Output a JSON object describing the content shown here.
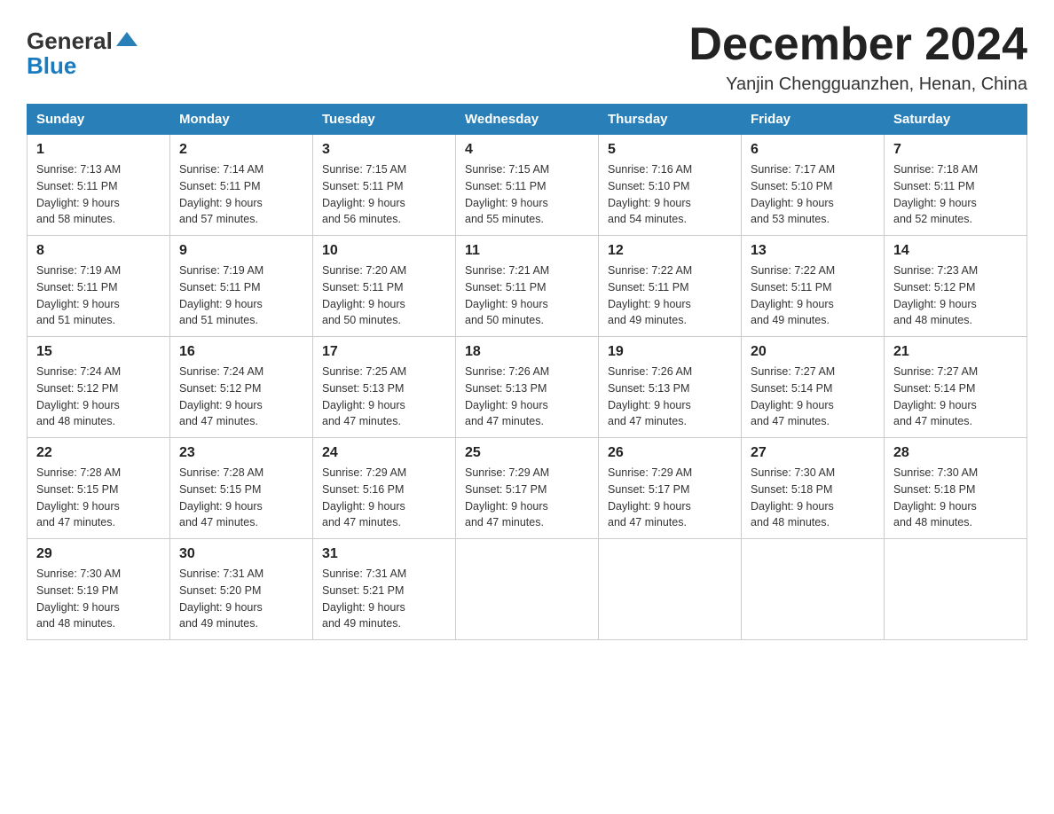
{
  "logo": {
    "general": "General",
    "blue": "Blue"
  },
  "header": {
    "title": "December 2024",
    "subtitle": "Yanjin Chengguanzhen, Henan, China"
  },
  "weekdays": [
    "Sunday",
    "Monday",
    "Tuesday",
    "Wednesday",
    "Thursday",
    "Friday",
    "Saturday"
  ],
  "weeks": [
    [
      {
        "day": "1",
        "sunrise": "7:13 AM",
        "sunset": "5:11 PM",
        "daylight": "9 hours and 58 minutes."
      },
      {
        "day": "2",
        "sunrise": "7:14 AM",
        "sunset": "5:11 PM",
        "daylight": "9 hours and 57 minutes."
      },
      {
        "day": "3",
        "sunrise": "7:15 AM",
        "sunset": "5:11 PM",
        "daylight": "9 hours and 56 minutes."
      },
      {
        "day": "4",
        "sunrise": "7:15 AM",
        "sunset": "5:11 PM",
        "daylight": "9 hours and 55 minutes."
      },
      {
        "day": "5",
        "sunrise": "7:16 AM",
        "sunset": "5:10 PM",
        "daylight": "9 hours and 54 minutes."
      },
      {
        "day": "6",
        "sunrise": "7:17 AM",
        "sunset": "5:10 PM",
        "daylight": "9 hours and 53 minutes."
      },
      {
        "day": "7",
        "sunrise": "7:18 AM",
        "sunset": "5:11 PM",
        "daylight": "9 hours and 52 minutes."
      }
    ],
    [
      {
        "day": "8",
        "sunrise": "7:19 AM",
        "sunset": "5:11 PM",
        "daylight": "9 hours and 51 minutes."
      },
      {
        "day": "9",
        "sunrise": "7:19 AM",
        "sunset": "5:11 PM",
        "daylight": "9 hours and 51 minutes."
      },
      {
        "day": "10",
        "sunrise": "7:20 AM",
        "sunset": "5:11 PM",
        "daylight": "9 hours and 50 minutes."
      },
      {
        "day": "11",
        "sunrise": "7:21 AM",
        "sunset": "5:11 PM",
        "daylight": "9 hours and 50 minutes."
      },
      {
        "day": "12",
        "sunrise": "7:22 AM",
        "sunset": "5:11 PM",
        "daylight": "9 hours and 49 minutes."
      },
      {
        "day": "13",
        "sunrise": "7:22 AM",
        "sunset": "5:11 PM",
        "daylight": "9 hours and 49 minutes."
      },
      {
        "day": "14",
        "sunrise": "7:23 AM",
        "sunset": "5:12 PM",
        "daylight": "9 hours and 48 minutes."
      }
    ],
    [
      {
        "day": "15",
        "sunrise": "7:24 AM",
        "sunset": "5:12 PM",
        "daylight": "9 hours and 48 minutes."
      },
      {
        "day": "16",
        "sunrise": "7:24 AM",
        "sunset": "5:12 PM",
        "daylight": "9 hours and 47 minutes."
      },
      {
        "day": "17",
        "sunrise": "7:25 AM",
        "sunset": "5:13 PM",
        "daylight": "9 hours and 47 minutes."
      },
      {
        "day": "18",
        "sunrise": "7:26 AM",
        "sunset": "5:13 PM",
        "daylight": "9 hours and 47 minutes."
      },
      {
        "day": "19",
        "sunrise": "7:26 AM",
        "sunset": "5:13 PM",
        "daylight": "9 hours and 47 minutes."
      },
      {
        "day": "20",
        "sunrise": "7:27 AM",
        "sunset": "5:14 PM",
        "daylight": "9 hours and 47 minutes."
      },
      {
        "day": "21",
        "sunrise": "7:27 AM",
        "sunset": "5:14 PM",
        "daylight": "9 hours and 47 minutes."
      }
    ],
    [
      {
        "day": "22",
        "sunrise": "7:28 AM",
        "sunset": "5:15 PM",
        "daylight": "9 hours and 47 minutes."
      },
      {
        "day": "23",
        "sunrise": "7:28 AM",
        "sunset": "5:15 PM",
        "daylight": "9 hours and 47 minutes."
      },
      {
        "day": "24",
        "sunrise": "7:29 AM",
        "sunset": "5:16 PM",
        "daylight": "9 hours and 47 minutes."
      },
      {
        "day": "25",
        "sunrise": "7:29 AM",
        "sunset": "5:17 PM",
        "daylight": "9 hours and 47 minutes."
      },
      {
        "day": "26",
        "sunrise": "7:29 AM",
        "sunset": "5:17 PM",
        "daylight": "9 hours and 47 minutes."
      },
      {
        "day": "27",
        "sunrise": "7:30 AM",
        "sunset": "5:18 PM",
        "daylight": "9 hours and 48 minutes."
      },
      {
        "day": "28",
        "sunrise": "7:30 AM",
        "sunset": "5:18 PM",
        "daylight": "9 hours and 48 minutes."
      }
    ],
    [
      {
        "day": "29",
        "sunrise": "7:30 AM",
        "sunset": "5:19 PM",
        "daylight": "9 hours and 48 minutes."
      },
      {
        "day": "30",
        "sunrise": "7:31 AM",
        "sunset": "5:20 PM",
        "daylight": "9 hours and 49 minutes."
      },
      {
        "day": "31",
        "sunrise": "7:31 AM",
        "sunset": "5:21 PM",
        "daylight": "9 hours and 49 minutes."
      },
      null,
      null,
      null,
      null
    ]
  ],
  "labels": {
    "sunrise_prefix": "Sunrise: ",
    "sunset_prefix": "Sunset: ",
    "daylight_prefix": "Daylight: "
  }
}
